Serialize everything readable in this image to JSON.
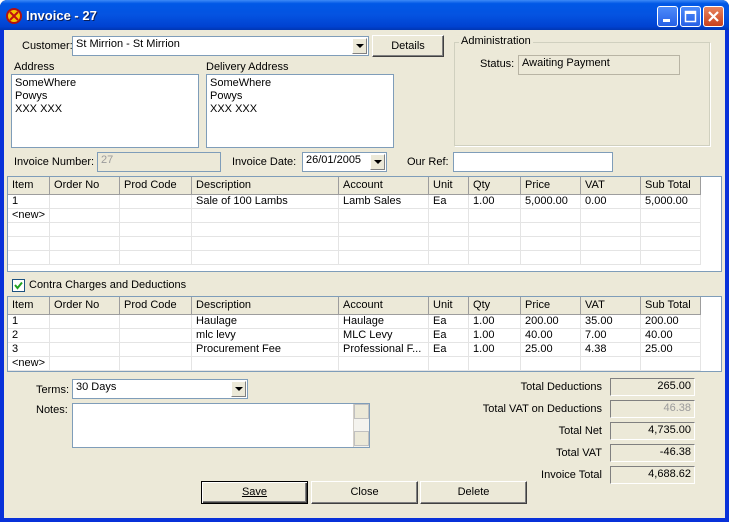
{
  "window": {
    "title": "Invoice - 27"
  },
  "header": {
    "customer_label": "Customer:",
    "customer_value": "St Mirrion - St Mirrion",
    "details_button": "Details",
    "address_label": "Address",
    "address_lines": [
      "SomeWhere",
      "Powys",
      "XXX XXX"
    ],
    "delivery_label": "Delivery Address",
    "delivery_lines": [
      "SomeWhere",
      "Powys",
      "XXX XXX"
    ],
    "admin_group": "Administration",
    "status_label": "Status:",
    "status_value": "Awaiting Payment",
    "invoice_number_label": "Invoice Number:",
    "invoice_number_value": "27",
    "invoice_date_label": "Invoice Date:",
    "invoice_date_value": "26/01/2005",
    "our_ref_label": "Our Ref:",
    "our_ref_value": ""
  },
  "columns": [
    "Item",
    "Order No",
    "Prod Code",
    "Description",
    "Account",
    "Unit",
    "Qty",
    "Price",
    "VAT",
    "Sub Total"
  ],
  "sales_lines": [
    [
      "1",
      "",
      "",
      "Sale of 100 Lambs",
      "Lamb Sales",
      "Ea",
      "1.00",
      "5,000.00",
      "0.00",
      "5,000.00"
    ],
    [
      "<new>",
      "",
      "",
      "",
      "",
      "",
      "",
      "",
      "",
      ""
    ]
  ],
  "contra": {
    "checkbox_label": "Contra Charges and Deductions",
    "checked": true,
    "lines": [
      [
        "1",
        "",
        "",
        "Haulage",
        "Haulage",
        "Ea",
        "1.00",
        "200.00",
        "35.00",
        "200.00"
      ],
      [
        "2",
        "",
        "",
        "mlc levy",
        "MLC Levy",
        "Ea",
        "1.00",
        "40.00",
        "7.00",
        "40.00"
      ],
      [
        "3",
        "",
        "",
        "Procurement Fee",
        "Professional F...",
        "Ea",
        "1.00",
        "25.00",
        "4.38",
        "25.00"
      ],
      [
        "<new>",
        "",
        "",
        "",
        "",
        "",
        "",
        "",
        "",
        ""
      ]
    ]
  },
  "footer": {
    "terms_label": "Terms:",
    "terms_value": "30 Days",
    "notes_label": "Notes:",
    "notes_value": "",
    "totals": [
      {
        "label": "Total Deductions",
        "value": "265.00",
        "readonly": false
      },
      {
        "label": "Total VAT on Deductions",
        "value": "46.38",
        "readonly": true
      },
      {
        "label": "Total Net",
        "value": "4,735.00",
        "readonly": false
      },
      {
        "label": "Total VAT",
        "value": "-46.38",
        "readonly": false
      },
      {
        "label": "Invoice Total",
        "value": "4,688.62",
        "readonly": false
      }
    ],
    "save_button": "Save",
    "close_button": "Close",
    "delete_button": "Delete"
  }
}
